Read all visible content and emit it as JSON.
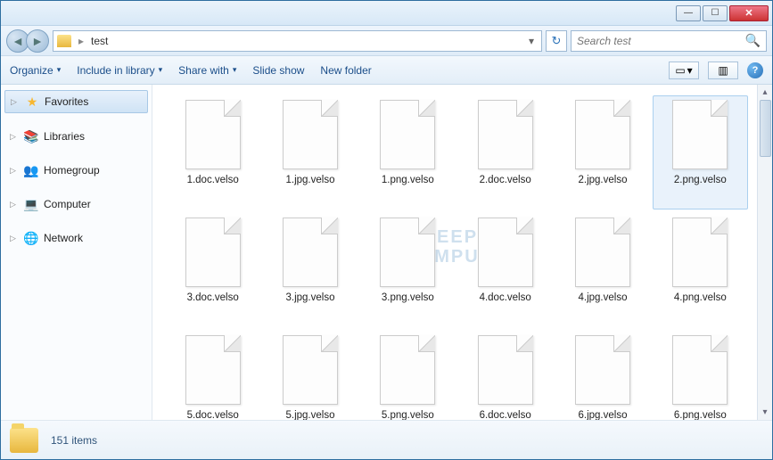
{
  "titlebar": {
    "minimize_glyph": "—",
    "maximize_glyph": "☐",
    "close_glyph": "✕"
  },
  "nav": {
    "back_glyph": "◄",
    "forward_glyph": "►",
    "breadcrumb": {
      "root_glyph": "▸",
      "current": "test"
    },
    "addr_dropdown_glyph": "▾",
    "refresh_glyph": "↻"
  },
  "search": {
    "placeholder": "Search test",
    "icon_glyph": "🔍"
  },
  "toolbar": {
    "organize": "Organize",
    "include": "Include in library",
    "share": "Share with",
    "slideshow": "Slide show",
    "newfolder": "New folder",
    "dd_glyph": "▾",
    "view_glyph": "▭",
    "preview_glyph": "▥",
    "help_glyph": "?"
  },
  "sidebar": {
    "items": [
      {
        "label": "Favorites",
        "icon": "star",
        "selected": true
      },
      {
        "label": "Libraries",
        "icon": "lib",
        "selected": false
      },
      {
        "label": "Homegroup",
        "icon": "hg",
        "selected": false
      },
      {
        "label": "Computer",
        "icon": "comp",
        "selected": false
      },
      {
        "label": "Network",
        "icon": "net",
        "selected": false
      }
    ],
    "tri_glyph": "▷"
  },
  "files": [
    {
      "name": "1.doc.velso",
      "selected": false
    },
    {
      "name": "1.jpg.velso",
      "selected": false
    },
    {
      "name": "1.png.velso",
      "selected": false
    },
    {
      "name": "2.doc.velso",
      "selected": false
    },
    {
      "name": "2.jpg.velso",
      "selected": false
    },
    {
      "name": "2.png.velso",
      "selected": true
    },
    {
      "name": "3.doc.velso",
      "selected": false
    },
    {
      "name": "3.jpg.velso",
      "selected": false
    },
    {
      "name": "3.png.velso",
      "selected": false
    },
    {
      "name": "4.doc.velso",
      "selected": false
    },
    {
      "name": "4.jpg.velso",
      "selected": false
    },
    {
      "name": "4.png.velso",
      "selected": false
    },
    {
      "name": "5.doc.velso",
      "selected": false
    },
    {
      "name": "5.jpg.velso",
      "selected": false
    },
    {
      "name": "5.png.velso",
      "selected": false
    },
    {
      "name": "6.doc.velso",
      "selected": false
    },
    {
      "name": "6.jpg.velso",
      "selected": false
    },
    {
      "name": "6.png.velso",
      "selected": false
    }
  ],
  "status": {
    "count_text": "151 items"
  },
  "watermark": {
    "line1": "BLEEPING",
    "line2": "COMPUTER"
  },
  "scroll": {
    "up_glyph": "▴",
    "down_glyph": "▾"
  }
}
